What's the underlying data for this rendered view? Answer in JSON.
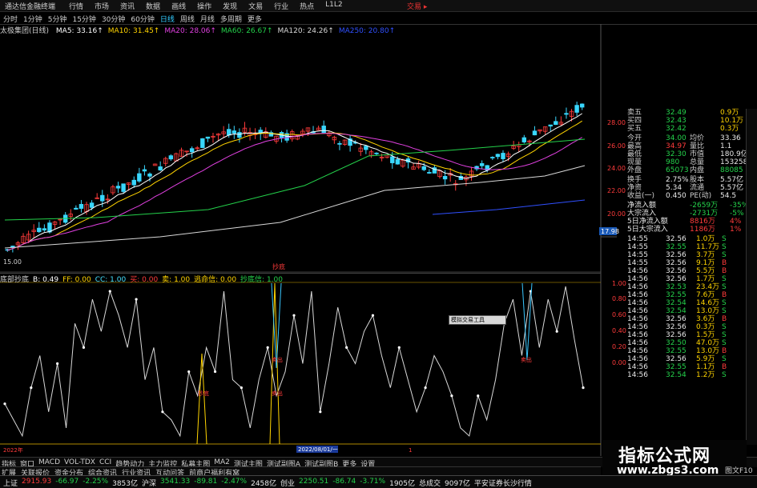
{
  "titlebar": {
    "app": "通达信金融终端",
    "menu": [
      "行情",
      "市场",
      "资讯",
      "数据",
      "画线",
      "操作",
      "发现",
      "文易",
      "行业",
      "热点",
      "L1L2"
    ],
    "right": "交易 ▸"
  },
  "toolbar": {
    "periods": [
      "分时",
      "1分钟",
      "5分钟",
      "15分钟",
      "30分钟",
      "60分钟",
      "日线",
      "周线",
      "月线",
      "多周期",
      "更多"
    ],
    "active": "日线"
  },
  "ma": {
    "stock": "太极集团(日线)",
    "items": [
      {
        "label": "MA5: 33.16↑",
        "color": "#ffffff"
      },
      {
        "label": "MA10: 31.45↑",
        "color": "#ffd400"
      },
      {
        "label": "MA20: 28.06↑",
        "color": "#e040e0"
      },
      {
        "label": "MA60: 26.67↑",
        "color": "#24d24b"
      },
      {
        "label": "MA120: 24.26↑",
        "color": "#d8d8d8"
      },
      {
        "label": "MA250: 20.80↑",
        "color": "#3050ff"
      }
    ]
  },
  "price_axis": {
    "labels": [
      "28.00",
      "26.00",
      "24.00",
      "22.00",
      "20.00",
      "18.00"
    ],
    "current": "17.98",
    "low_label": "15.00"
  },
  "indicator": {
    "items": [
      {
        "label": "底部抄底",
        "color": "#cfcfcf"
      },
      {
        "label": "B: 0.49",
        "color": "#ffffff"
      },
      {
        "label": "FF: 0.00",
        "color": "#ffd400"
      },
      {
        "label": "CC: 1.00",
        "color": "#44e0ff"
      },
      {
        "label": "买: 0.00",
        "color": "#ff3b3b"
      },
      {
        "label": "卖: 1.00",
        "color": "#ffd400"
      },
      {
        "label": "逃命信: 0.00",
        "color": "#ffd400"
      },
      {
        "label": "抄底信: 1.00",
        "color": "#24d24b"
      }
    ],
    "axis": [
      "1.00",
      "0.80",
      "0.60",
      "0.40",
      "0.20",
      "0.00"
    ],
    "markers": [
      {
        "text": "抄底",
        "color": "#ff3b3b"
      },
      {
        "text": "抄底",
        "color": "#ff3b3b"
      },
      {
        "text": "卖出",
        "color": "#ff3b3b"
      },
      {
        "text": "卖出",
        "color": "#ff3b3b"
      },
      {
        "text": "卖出",
        "color": "#ff3b3b"
      }
    ],
    "tooltip": "模拟交易工具"
  },
  "date_axis": {
    "left": "2022年",
    "mid": "2022/08/01/一",
    "tick": "1"
  },
  "quote": {
    "book": [
      {
        "label": "卖五",
        "price": "32.49",
        "vol": "0.9万"
      },
      {
        "label": "买四",
        "price": "32.43",
        "vol": "10.1万"
      },
      {
        "label": "买五",
        "price": "32.42",
        "vol": "0.3万"
      }
    ],
    "stats": [
      {
        "k1": "今开",
        "v1": "34.00",
        "k2": "均价",
        "v2": "33.36"
      },
      {
        "k1": "最高",
        "v1": "34.97",
        "k2": "量比",
        "v2": "1.1"
      },
      {
        "k1": "最低",
        "v1": "32.30",
        "k2": "市值",
        "v2": "180.9亿"
      },
      {
        "k1": "现量",
        "v1": "980",
        "k2": "总量",
        "v2": "153258"
      },
      {
        "k1": "外盘",
        "v1": "65073",
        "k2": "内盘",
        "v2": "88085"
      },
      {
        "k1": "换手",
        "v1": "2.75%",
        "k2": "股本",
        "v2": "5.57亿"
      },
      {
        "k1": "净资",
        "v1": "5.34",
        "k2": "流通",
        "v2": "5.57亿"
      },
      {
        "k1": "收益(一)",
        "v1": "0.450",
        "k2": "PE(动)",
        "v2": "54.5"
      }
    ],
    "flow": [
      {
        "label": "净流入额",
        "value": "-2659万",
        "pct": "-35%"
      },
      {
        "label": "大宗流入",
        "value": "-2731万",
        "pct": "-5%"
      },
      {
        "label": "5日净流入额",
        "value": "8816万",
        "pct": "4%"
      },
      {
        "label": "5日大宗流入",
        "value": "1186万",
        "pct": "1%"
      }
    ],
    "ticks": [
      {
        "time": "14:55",
        "price": "32.56",
        "vol": "1.0万",
        "side": "S"
      },
      {
        "time": "14:55",
        "price": "32.55",
        "vol": "11.7万",
        "side": "S"
      },
      {
        "time": "14:55",
        "price": "32.56",
        "vol": "3.7万",
        "side": "S"
      },
      {
        "time": "14:55",
        "price": "32.56",
        "vol": "9.1万",
        "side": "B"
      },
      {
        "time": "14:56",
        "price": "32.56",
        "vol": "5.5万",
        "side": "B"
      },
      {
        "time": "14:56",
        "price": "32.56",
        "vol": "1.7万",
        "side": "S"
      },
      {
        "time": "14:56",
        "price": "32.53",
        "vol": "23.4万",
        "side": "S"
      },
      {
        "time": "14:56",
        "price": "32.55",
        "vol": "7.6万",
        "side": "B"
      },
      {
        "time": "14:56",
        "price": "32.54",
        "vol": "14.6万",
        "side": "S"
      },
      {
        "time": "14:56",
        "price": "32.54",
        "vol": "13.0万",
        "side": "S"
      },
      {
        "time": "14:56",
        "price": "32.56",
        "vol": "3.6万",
        "side": "B"
      },
      {
        "time": "14:56",
        "price": "32.56",
        "vol": "0.3万",
        "side": "S"
      },
      {
        "time": "14:56",
        "price": "32.56",
        "vol": "1.5万",
        "side": "S"
      },
      {
        "time": "14:56",
        "price": "32.50",
        "vol": "47.0万",
        "side": "S"
      },
      {
        "time": "14:56",
        "price": "32.55",
        "vol": "13.0万",
        "side": "B"
      },
      {
        "time": "14:56",
        "price": "32.56",
        "vol": "5.9万",
        "side": "S"
      },
      {
        "time": "14:56",
        "price": "32.55",
        "vol": "1.1万",
        "side": "B"
      },
      {
        "time": "14:56",
        "price": "32.54",
        "vol": "1.2万",
        "side": "S"
      }
    ]
  },
  "tabs": [
    "指标",
    "窗口",
    "MACD",
    "VOL-TDX",
    "CCI",
    "趋势动力",
    "主力监控",
    "私募主图",
    "MA2",
    "测试主图",
    "测试副图A",
    "测试副图B",
    "更多",
    "设置"
  ],
  "tabs2": [
    "扩展",
    "关联报价",
    "资金分布",
    "综合资讯",
    "行业资讯",
    "互动问答",
    "前商户福利有窝"
  ],
  "watermark": {
    "cn": "指标公式网",
    "url": "www.zbgs3.com"
  },
  "status": [
    {
      "t": "上证",
      "c": "#e8e8e8"
    },
    {
      "t": "2915.93",
      "c": "#ff3b3b"
    },
    {
      "t": "-66.97",
      "c": "#24d24b"
    },
    {
      "t": "-2.25%",
      "c": "#24d24b"
    },
    {
      "t": "3853亿",
      "c": "#e8e8e8"
    },
    {
      "t": "沪深",
      "c": "#e8e8e8"
    },
    {
      "t": "3541.33",
      "c": "#24d24b"
    },
    {
      "t": "-89.81",
      "c": "#24d24b"
    },
    {
      "t": "-2.47%",
      "c": "#24d24b"
    },
    {
      "t": "2458亿",
      "c": "#e8e8e8"
    },
    {
      "t": "创业",
      "c": "#e8e8e8"
    },
    {
      "t": "2250.51",
      "c": "#24d24b"
    },
    {
      "t": "-86.74",
      "c": "#24d24b"
    },
    {
      "t": "-3.71%",
      "c": "#24d24b"
    },
    {
      "t": "1905亿",
      "c": "#e8e8e8"
    },
    {
      "t": "总成交",
      "c": "#e8e8e8"
    },
    {
      "t": "9097亿",
      "c": "#e8e8e8"
    },
    {
      "t": "平安证券长沙行情",
      "c": "#e8e8e8"
    }
  ],
  "status_right": "图文F10"
}
